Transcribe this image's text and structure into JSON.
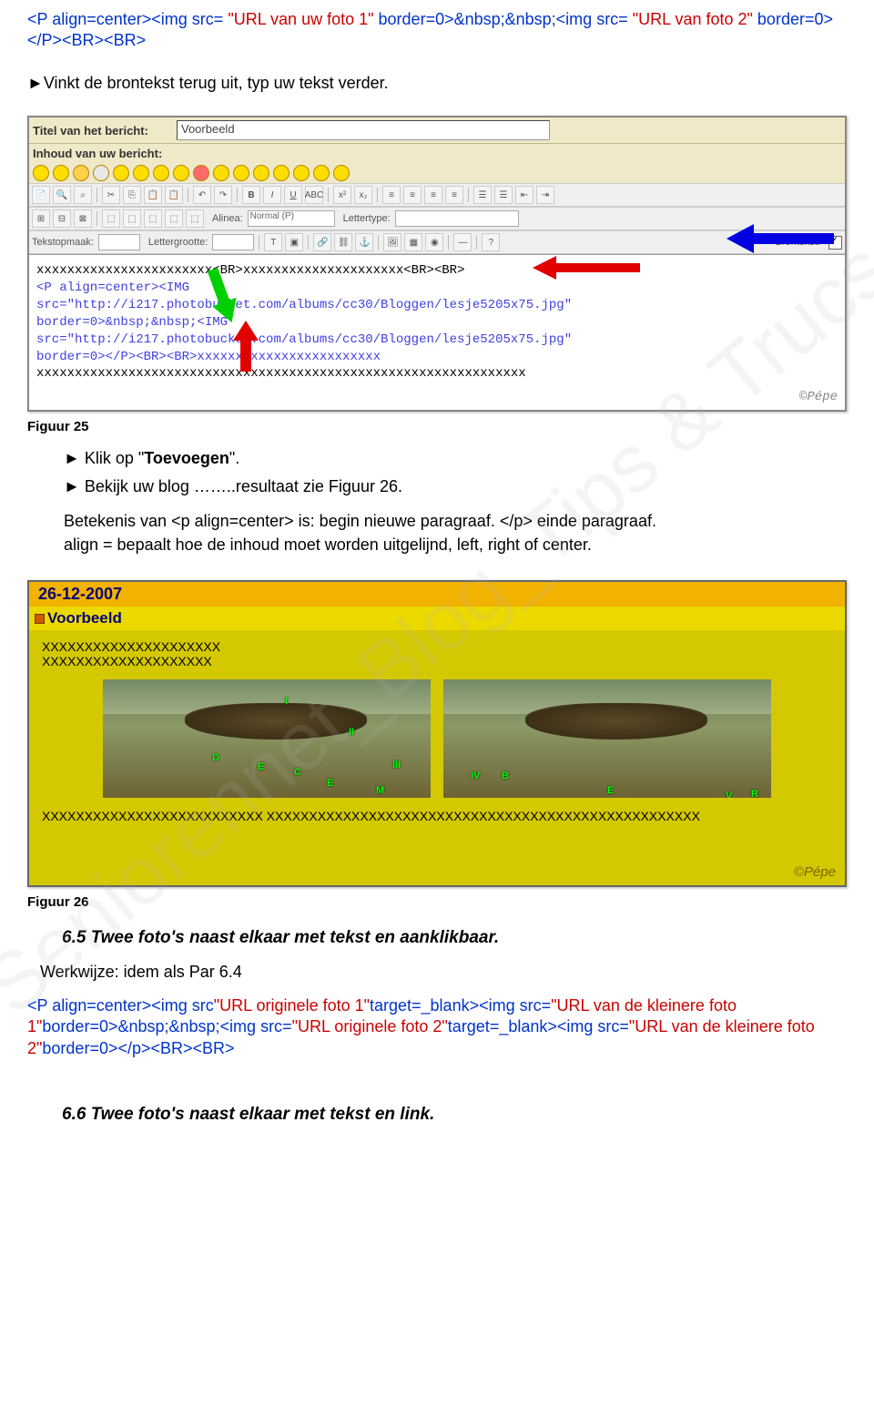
{
  "code1": {
    "l1a": "<P align=center><img src=",
    "l1b": "\"URL van uw foto 1\"",
    "l1c": "border=0>&nbsp;&nbsp;<img src=",
    "l2a": "\"URL van foto 2\"",
    "l2b": "border=0></P><BR><BR>"
  },
  "step_vinkt": "►Vinkt  de brontekst terug uit, typ uw tekst verder.",
  "editor": {
    "title_label": "Titel van het bericht:",
    "title_value": "Voorbeeld",
    "content_label": "Inhoud van uw bericht:",
    "tb": {
      "alinea": "Alinea:",
      "normal": "Normal (P)",
      "lettertype": "Lettertype:",
      "tekstopmaak": "Tekstopmaak:",
      "lettergrootte": "Lettergrootte:",
      "brontekst": "Brontekst:"
    },
    "src_line1": "xxxxxxxxxxxxxxxxxxxxxxx<BR>xxxxxxxxxxxxxxxxxxxxx<BR><BR>",
    "src_line2": "<P align=center><IMG",
    "src_line3": "src=\"http://i217.photobucket.com/albums/cc30/Bloggen/lesje5205x75.jpg\"",
    "src_line4": "border=0>&nbsp;&nbsp;<IMG",
    "src_line5": "src=\"http://i217.photobucket.com/albums/cc30/Bloggen/lesje5205x75.jpg\"",
    "src_line6": "border=0></P><BR><BR>xxxxxxxxxxxxxxxxxxxxxxxx",
    "src_line7": "xxxxxxxxxxxxxxxxxxxxxxxxxxxxxxxxxxxxxxxxxxxxxxxxxxxxxxxxxxxxxxxx",
    "sig": "©Pépe"
  },
  "caption25": "Figuur 25",
  "step_klik": "► Klik op \"Toevoegen\".",
  "step_bekijk": "► Bekijk uw blog ……..resultaat zie Figuur 26.",
  "explain1": "Betekenis van <p align=center> is: begin nieuwe paragraaf. </p> einde paragraaf.",
  "explain2": "align = bepaalt hoe de inhoud moet worden uitgelijnd, left, right of center.",
  "blog": {
    "date": "26-12-2007",
    "title": "Voorbeeld",
    "line1": "XXXXXXXXXXXXXXXXXXXXX",
    "line2": "XXXXXXXXXXXXXXXXXXXX",
    "line3": "XXXXXXXXXXXXXXXXXXXXXXXXXX XXXXXXXXXXXXXXXXXXXXXXXXXXXXXXXXXXXXXXXXXXXXXXXXXXX",
    "sig": "©Pépe",
    "markers": [
      "D",
      "E",
      "C",
      "E",
      "M",
      "B",
      "E",
      "R",
      "I",
      "II",
      "III",
      "IV",
      "V"
    ]
  },
  "caption26": "Figuur 26",
  "section65": "6.5  Twee foto's naast elkaar met tekst en aanklikbaar.",
  "werkwijze": "Werkwijze: idem als Par 6.4",
  "code2": {
    "l1a": "<P align=center><img src",
    "l1b": "\"URL originele foto 1\"",
    "l1c": "target=_blank><img src=",
    "l1d": "\"URL van de kleinere foto 1\"",
    "l1e": "border=0>&nbsp;&nbsp;<img src=",
    "l1f": "\"URL originele foto 2\"",
    "l1g": "target=_blank><img src=",
    "l1h": "\"URL van de kleinere foto 2\"",
    "l1i": "border=0></p><BR><BR>"
  },
  "section66": "6.6  Twee foto's naast elkaar met tekst en link."
}
